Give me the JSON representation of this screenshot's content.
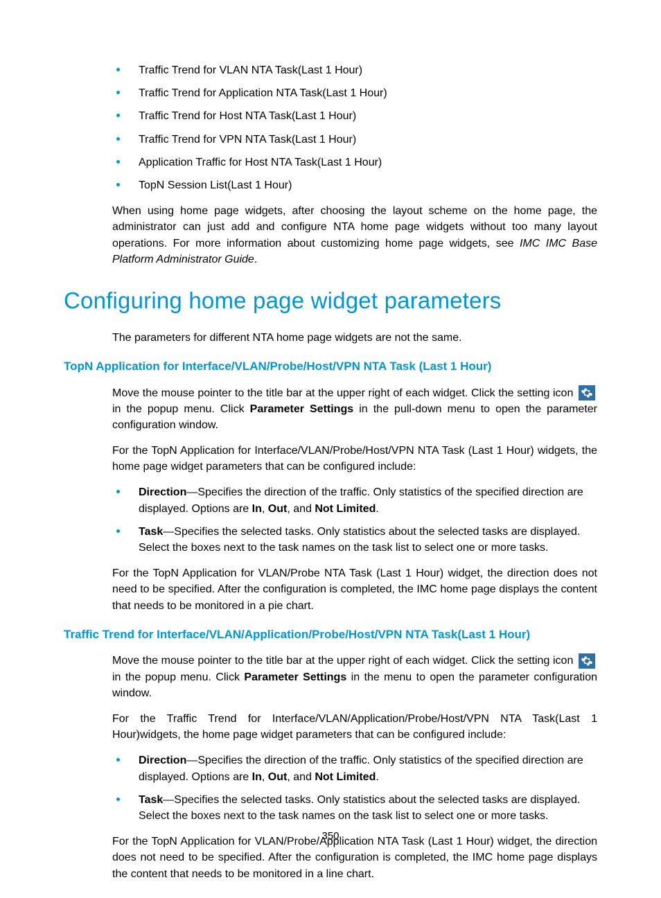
{
  "topBullets": [
    "Traffic Trend for VLAN NTA Task(Last 1 Hour)",
    "Traffic Trend for Application NTA Task(Last 1 Hour)",
    "Traffic Trend for Host NTA Task(Last 1 Hour)",
    "Traffic Trend for VPN NTA Task(Last 1 Hour)",
    "Application Traffic for Host NTA Task(Last 1 Hour)",
    "TopN Session List(Last 1 Hour)"
  ],
  "introParaPart1": "When using home page widgets, after choosing the layout scheme on the home page, the administrator can just add and configure NTA home page widgets without too many layout operations. For more information about customizing home page widgets, see ",
  "introParaItalic": "IMC IMC Base Platform Administrator Guide",
  "introParaEnd": ".",
  "h1": "Configuring home page widget parameters",
  "h1Intro": "The parameters for different NTA home page widgets are not the same.",
  "sub1": {
    "title": "TopN Application for Interface/VLAN/Probe/Host/VPN NTA Task (Last 1 Hour)",
    "p1a": "Move the mouse pointer to the title bar at the upper right of each widget. Click the setting icon ",
    "p1b": " in the popup menu. Click ",
    "p1bold": "Parameter Settings",
    "p1c": " in the pull-down menu to open the parameter configuration window.",
    "p2": "For the TopN Application for Interface/VLAN/Probe/Host/VPN NTA Task (Last 1 Hour) widgets, the home page widget parameters that can be configured include:",
    "dirLabel": "Direction",
    "dirTextA": "—Specifies the direction of the traffic. Only statistics of the specified direction are displayed. Options are ",
    "dirIn": "In",
    "dirComma": ", ",
    "dirOut": "Out",
    "dirAnd": ", and ",
    "dirNL": "Not Limited",
    "dirEnd": ".",
    "taskLabel": "Task",
    "taskText": "—Specifies the selected tasks. Only statistics about the selected tasks are displayed. Select the boxes next to the task names on the task list to select one or more tasks.",
    "p3": "For the TopN Application for VLAN/Probe NTA Task (Last 1 Hour) widget, the direction does not need to be specified. After the configuration is completed, the IMC home page displays the content that needs to be monitored in a pie chart."
  },
  "sub2": {
    "title": "Traffic Trend for Interface/VLAN/Application/Probe/Host/VPN NTA Task(Last 1 Hour)",
    "p1a": "Move the mouse pointer to the title bar at the upper right of each widget. Click the setting icon ",
    "p1b": " in the popup menu. Click ",
    "p1bold": "Parameter Settings",
    "p1c": " in the menu to open the parameter configuration window.",
    "p2": "For the Traffic Trend for Interface/VLAN/Application/Probe/Host/VPN NTA Task(Last 1 Hour)widgets, the home page widget parameters that can be configured include:",
    "dirLabel": "Direction",
    "dirTextA": "—Specifies the direction of the traffic. Only statistics of the specified direction are displayed. Options are ",
    "dirIn": "In",
    "dirComma": ", ",
    "dirOut": "Out",
    "dirAnd": ", and ",
    "dirNL": "Not Limited",
    "dirEnd": ".",
    "taskLabel": "Task",
    "taskText": "—Specifies the selected tasks. Only statistics about the selected tasks are displayed. Select the boxes next to the task names on the task list to select one or more tasks.",
    "p3": "For the TopN Application for VLAN/Probe/Application NTA Task (Last 1 Hour) widget, the direction does not need to be specified. After the configuration is completed, the IMC home page displays the content that needs to be monitored in a line chart."
  },
  "pageNumber": "350"
}
